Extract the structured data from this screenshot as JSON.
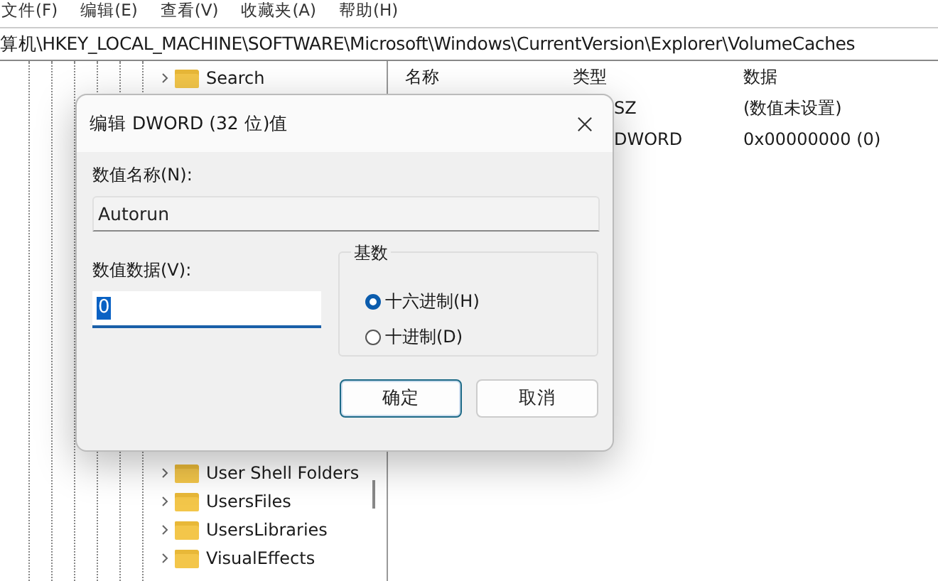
{
  "menu": [
    {
      "label": "文件(F)"
    },
    {
      "label": "编辑(E)"
    },
    {
      "label": "查看(V)"
    },
    {
      "label": "收藏夹(A)"
    },
    {
      "label": "帮助(H)"
    }
  ],
  "address": "算机\\HKEY_LOCAL_MACHINE\\SOFTWARE\\Microsoft\\Windows\\CurrentVersion\\Explorer\\VolumeCaches",
  "tree": {
    "top_items": [
      {
        "label": "Search",
        "expanded": false
      }
    ],
    "bottom_items": [
      {
        "label": "User Shell Folders",
        "expanded": false
      },
      {
        "label": "UsersFiles",
        "expanded": false
      },
      {
        "label": "UsersLibraries",
        "expanded": false
      },
      {
        "label": "VisualEffects",
        "expanded": false
      }
    ]
  },
  "list": {
    "columns": [
      "名称",
      "类型",
      "数据"
    ],
    "rows": [
      {
        "type": "SZ",
        "data": "(数值未设置)"
      },
      {
        "type": "DWORD",
        "data": "0x00000000 (0)"
      }
    ]
  },
  "dialog": {
    "title": "编辑 DWORD (32 位)值",
    "name_label": "数值名称(N):",
    "name_value": "Autorun",
    "data_label": "数值数据(V):",
    "data_value": "0",
    "base": {
      "title": "基数",
      "options": [
        {
          "label": "十六进制(H)",
          "selected": true
        },
        {
          "label": "十进制(D)",
          "selected": false
        }
      ]
    },
    "buttons": [
      {
        "label": "确定",
        "default": true
      },
      {
        "label": "取消",
        "default": false
      }
    ]
  }
}
